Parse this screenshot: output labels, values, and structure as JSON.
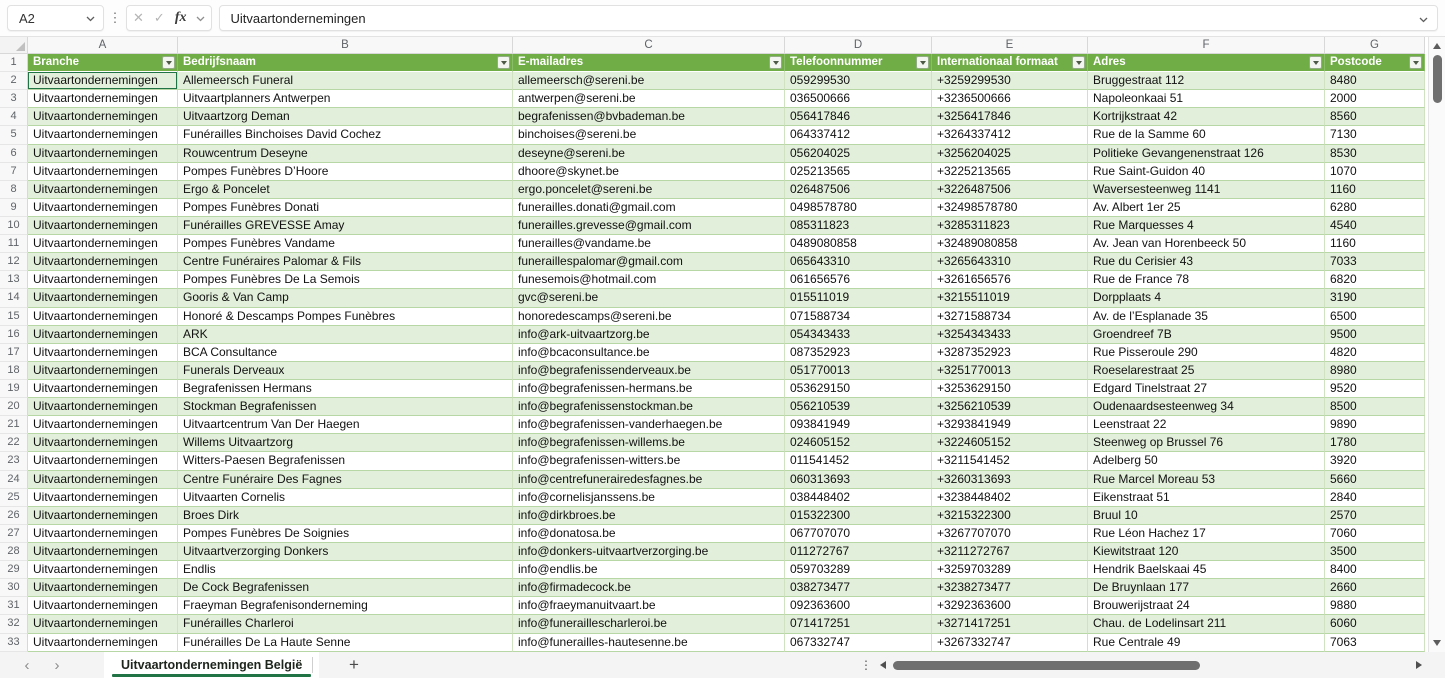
{
  "formula_bar": {
    "cell_reference": "A2",
    "cancel_icon": "✕",
    "confirm_icon": "✓",
    "fx_label": "fx",
    "formula_value": "Uitvaartondernemingen"
  },
  "columns": {
    "letters": [
      "A",
      "B",
      "C",
      "D",
      "E",
      "F",
      "G"
    ],
    "headers": [
      "Branche",
      "Bedrijfsnaam",
      "E-mailadres",
      "Telefoonnummer",
      "Internationaal formaat",
      "Adres",
      "Postcode"
    ]
  },
  "table": {
    "first_row_number": 1,
    "rows": [
      [
        "Uitvaartondernemingen",
        "Allemeersch Funeral",
        "allemeersch@sereni.be",
        "059299530",
        "+3259299530",
        "Bruggestraat 112",
        "8480"
      ],
      [
        "Uitvaartondernemingen",
        "Uitvaartplanners Antwerpen",
        "antwerpen@sereni.be",
        "036500666",
        "+3236500666",
        "Napoleonkaai 51",
        "2000"
      ],
      [
        "Uitvaartondernemingen",
        "Uitvaartzorg Deman",
        "begrafenissen@bvbademan.be",
        "056417846",
        "+3256417846",
        "Kortrijkstraat 42",
        "8560"
      ],
      [
        "Uitvaartondernemingen",
        "Funérailles Binchoises David Cochez",
        "binchoises@sereni.be",
        "064337412",
        "+3264337412",
        "Rue de la Samme 60",
        "7130"
      ],
      [
        "Uitvaartondernemingen",
        "Rouwcentrum Deseyne",
        "deseyne@sereni.be",
        "056204025",
        "+3256204025",
        "Politieke Gevangenenstraat 126",
        "8530"
      ],
      [
        "Uitvaartondernemingen",
        "Pompes Funèbres D’Hoore",
        "dhoore@skynet.be",
        "025213565",
        "+3225213565",
        "Rue Saint-Guidon 40",
        "1070"
      ],
      [
        "Uitvaartondernemingen",
        "Ergo & Poncelet",
        "ergo.poncelet@sereni.be",
        "026487506",
        "+3226487506",
        "Waversesteenweg 1141",
        "1160"
      ],
      [
        "Uitvaartondernemingen",
        "Pompes Funèbres Donati",
        "funerailles.donati@gmail.com",
        "0498578780",
        "+32498578780",
        "Av. Albert 1er 25",
        "6280"
      ],
      [
        "Uitvaartondernemingen",
        "Funérailles GREVESSE Amay",
        "funerailles.grevesse@gmail.com",
        "085311823",
        "+3285311823",
        "Rue Marquesses 4",
        "4540"
      ],
      [
        "Uitvaartondernemingen",
        "Pompes Funèbres Vandame",
        "funerailles@vandame.be",
        "0489080858",
        "+32489080858",
        "Av. Jean van Horenbeeck 50",
        "1160"
      ],
      [
        "Uitvaartondernemingen",
        "Centre Funéraires Palomar & Fils",
        "funeraillespalomar@gmail.com",
        "065643310",
        "+3265643310",
        "Rue du Cerisier 43",
        "7033"
      ],
      [
        "Uitvaartondernemingen",
        "Pompes Funèbres De La Semois",
        "funesemois@hotmail.com",
        "061656576",
        "+3261656576",
        "Rue de France 78",
        "6820"
      ],
      [
        "Uitvaartondernemingen",
        "Gooris & Van Camp",
        "gvc@sereni.be",
        "015511019",
        "+3215511019",
        "Dorpplaats 4",
        "3190"
      ],
      [
        "Uitvaartondernemingen",
        "Honoré & Descamps Pompes Funèbres",
        "honoredescamps@sereni.be",
        "071588734",
        "+3271588734",
        "Av. de l’Esplanade 35",
        "6500"
      ],
      [
        "Uitvaartondernemingen",
        "ARK",
        "info@ark-uitvaartzorg.be",
        "054343433",
        "+3254343433",
        "Groendreef 7B",
        "9500"
      ],
      [
        "Uitvaartondernemingen",
        "BCA Consultance",
        "info@bcaconsultance.be",
        "087352923",
        "+3287352923",
        "Rue Pisseroule 290",
        "4820"
      ],
      [
        "Uitvaartondernemingen",
        "Funerals Derveaux",
        "info@begrafenissenderveaux.be",
        "051770013",
        "+3251770013",
        "Roeselarestraat 25",
        "8980"
      ],
      [
        "Uitvaartondernemingen",
        "Begrafenissen Hermans",
        "info@begrafenissen-hermans.be",
        "053629150",
        "+3253629150",
        "Edgard Tinelstraat 27",
        "9520"
      ],
      [
        "Uitvaartondernemingen",
        "Stockman Begrafenissen",
        "info@begrafenissenstockman.be",
        "056210539",
        "+3256210539",
        "Oudenaardsesteenweg 34",
        "8500"
      ],
      [
        "Uitvaartondernemingen",
        "Uitvaartcentrum Van Der Haegen",
        "info@begrafenissen-vanderhaegen.be",
        "093841949",
        "+3293841949",
        "Leenstraat 22",
        "9890"
      ],
      [
        "Uitvaartondernemingen",
        "Willems Uitvaartzorg",
        "info@begrafenissen-willems.be",
        "024605152",
        "+3224605152",
        "Steenweg op Brussel 76",
        "1780"
      ],
      [
        "Uitvaartondernemingen",
        "Witters-Paesen Begrafenissen",
        "info@begrafenissen-witters.be",
        "011541452",
        "+3211541452",
        "Adelberg 50",
        "3920"
      ],
      [
        "Uitvaartondernemingen",
        "Centre Funéraire Des Fagnes",
        "info@centrefunerairedesfagnes.be",
        "060313693",
        "+3260313693",
        "Rue Marcel Moreau 53",
        "5660"
      ],
      [
        "Uitvaartondernemingen",
        "Uitvaarten Cornelis",
        "info@cornelisjanssens.be",
        "038448402",
        "+3238448402",
        "Eikenstraat 51",
        "2840"
      ],
      [
        "Uitvaartondernemingen",
        "Broes Dirk",
        "info@dirkbroes.be",
        "015322300",
        "+3215322300",
        "Bruul 10",
        "2570"
      ],
      [
        "Uitvaartondernemingen",
        "Pompes Funèbres De Soignies",
        "info@donatosa.be",
        "067707070",
        "+3267707070",
        "Rue Léon Hachez 17",
        "7060"
      ],
      [
        "Uitvaartondernemingen",
        "Uitvaartverzorging Donkers",
        "info@donkers-uitvaartverzorging.be",
        "011272767",
        "+3211272767",
        "Kiewitstraat 120",
        "3500"
      ],
      [
        "Uitvaartondernemingen",
        "Endlis",
        "info@endlis.be",
        "059703289",
        "+3259703289",
        "Hendrik Baelskaai 45",
        "8400"
      ],
      [
        "Uitvaartondernemingen",
        "De Cock Begrafenissen",
        "info@firmadecock.be",
        "038273477",
        "+3238273477",
        "De Bruynlaan 177",
        "2660"
      ],
      [
        "Uitvaartondernemingen",
        "Fraeyman Begrafenisonderneming",
        "info@fraeymanuitvaart.be",
        "092363600",
        "+3292363600",
        "Brouwerijstraat 24",
        "9880"
      ],
      [
        "Uitvaartondernemingen",
        "Funérailles Charleroi",
        "info@funeraillescharleroi.be",
        "071417251",
        "+3271417251",
        "Chau. de Lodelinsart 211",
        "6060"
      ],
      [
        "Uitvaartondernemingen",
        "Funérailles De La Haute Senne",
        "info@funerailles-hautesenne.be",
        "067332747",
        "+3267332747",
        "Rue Centrale 49",
        "7063"
      ]
    ]
  },
  "selection": {
    "active_cell": "A2"
  },
  "sheet_bar": {
    "tab_name": "Uitvaartondernemingen België",
    "add_sheet_label": "+"
  },
  "colors": {
    "header_green": "#70AD47",
    "band_green": "#E2EFDA",
    "grid_line": "#b7d7a4",
    "grid_line_v": "#cfe3c0",
    "tab_underline": "#217346"
  }
}
